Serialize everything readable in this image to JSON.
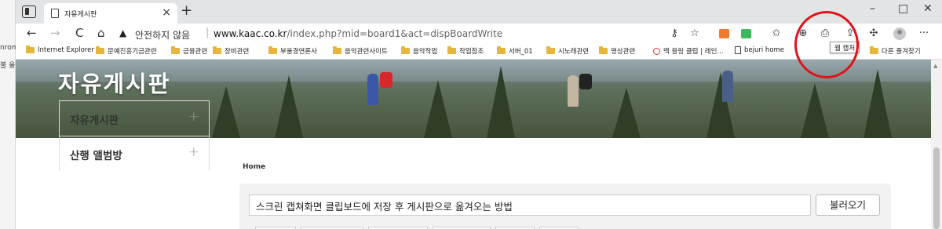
{
  "background_window": {
    "fragments": [
      "nrom",
      "불 올"
    ]
  },
  "browser": {
    "tab": {
      "title": "자유게시판",
      "close": "×"
    },
    "new_tab": "+",
    "window_controls": {
      "minimize": "–",
      "maximize": "□",
      "close": "✕"
    },
    "nav": {
      "back": "←",
      "forward": "→",
      "refresh": "C",
      "home": "⌂"
    },
    "address": {
      "warning_icon": "▲",
      "insecure_label": "안전하지 않음",
      "separator": "|",
      "host": "www.kaac.co.kr",
      "path": "/index.php?mid=board1&act=dispBoardWrite"
    },
    "toolbar_icons": [
      "key-icon",
      "favorite-add-icon",
      "extension-orange-icon",
      "extension-green-icon",
      "favorites-icon",
      "collections-icon",
      "web-capture-icon",
      "share-icon",
      "extensions-icon",
      "profile-icon",
      "more-icon"
    ],
    "tooltip": "웹 캡처",
    "favorites": [
      {
        "label": "Internet Explorer",
        "icon": "folder"
      },
      {
        "label": "문예진흥기금관련",
        "icon": "folder"
      },
      {
        "label": "금융관련",
        "icon": "folder"
      },
      {
        "label": "장비관련",
        "icon": "folder"
      },
      {
        "label": "부울경연론사",
        "icon": "folder"
      },
      {
        "label": "음악관련사이트",
        "icon": "folder"
      },
      {
        "label": "음악작업",
        "icon": "folder"
      },
      {
        "label": "작업참조",
        "icon": "folder"
      },
      {
        "label": "서버_01",
        "icon": "folder"
      },
      {
        "label": "시노래관련",
        "icon": "folder"
      },
      {
        "label": "영상관련",
        "icon": "folder"
      },
      {
        "label": "맥 블링 클럽 | 레인...",
        "icon": "red-circle"
      },
      {
        "label": "bejuri home",
        "icon": "document"
      }
    ],
    "other_favorites": "다른 즐겨찾기",
    "annotation_color": "#e0131b"
  },
  "page": {
    "hero_title": "자유게시판",
    "sidebar": [
      {
        "label": "자유게시판",
        "expand": "+"
      },
      {
        "label": "산행 앨범방",
        "expand": "+"
      }
    ],
    "breadcrumb": "Home",
    "editor": {
      "title_value": "스크린 캡쳐화면 클립보드에 저장 후 게시판으로 옮겨오는 방법",
      "load_button": "불러오기"
    }
  }
}
